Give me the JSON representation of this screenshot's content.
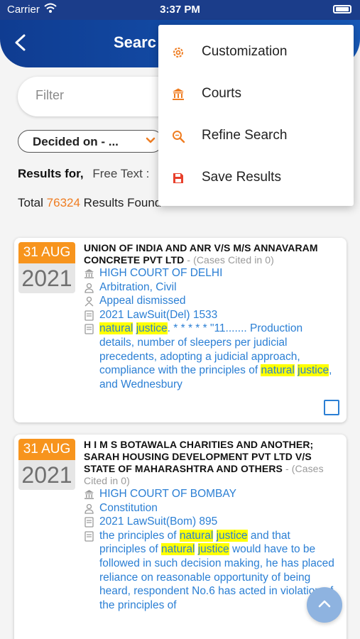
{
  "status_bar": {
    "carrier": "Carrier",
    "time": "3:37 PM"
  },
  "header": {
    "title": "Searc"
  },
  "filter": {
    "placeholder": "Filter",
    "value": ""
  },
  "sort": {
    "selected": "Decided on - ..."
  },
  "results": {
    "label": "Results for,",
    "free_text": "Free Text :",
    "total_prefix": "Total",
    "total_count": "76324",
    "total_suffix": "Results Found"
  },
  "menu": {
    "items": [
      {
        "label": "Customization",
        "icon": "customization-gear-icon"
      },
      {
        "label": "Courts",
        "icon": "court-building-icon"
      },
      {
        "label": "Refine Search",
        "icon": "refine-search-magnifier-icon"
      },
      {
        "label": "Save Results",
        "icon": "floppy-save-icon"
      }
    ]
  },
  "cards": [
    {
      "day_month": "31 AUG",
      "year": "2021",
      "title": "UNION OF INDIA AND ANR V/S M/S ANNAVARAM CONCRETE PVT LTD",
      "cited": " - (Cases Cited in 0)",
      "court": "HIGH COURT OF DELHI",
      "subject": "Arbitration, Civil",
      "outcome": "Appeal dismissed",
      "citation": "2021 LawSuit(Del) 1533",
      "snippet": {
        "t1": "natural",
        "t2": " ",
        "t3": "justice",
        "t4": ". * * * * * \"11....... Production details, number of sleepers per judicial precedents, adopting a judicial approach, compliance with the principles of ",
        "t5": "natural",
        "t6": " ",
        "t7": "justice",
        "t8": ", and Wednesbury"
      }
    },
    {
      "day_month": "31 AUG",
      "year": "2021",
      "title": "H I M S BOTAWALA CHARITIES AND ANOTHER; SARAH HOUSING DEVELOPMENT PVT LTD V/S STATE OF MAHARASHTRA AND OTHERS",
      "cited": " - (Cases Cited in 0)",
      "court": "HIGH COURT OF BOMBAY",
      "subject": "Constitution",
      "citation": "2021 LawSuit(Bom) 895",
      "snippet": {
        "t1": "the principles of ",
        "t2": "natural",
        "t3": " ",
        "t4": "justice",
        "t5": " and that principles of ",
        "t6": "natural",
        "t7": " ",
        "t8": "justice",
        "t9": " would have to be followed in such decision making, he has placed reliance on reasonable opportunity of being heard, respondent No.6 has acted in violation of the principles of"
      }
    }
  ],
  "colors": {
    "header": "#1b4fa8",
    "accent": "#f7941d",
    "link": "#2b7fd4",
    "highlight": "#ffff00"
  }
}
